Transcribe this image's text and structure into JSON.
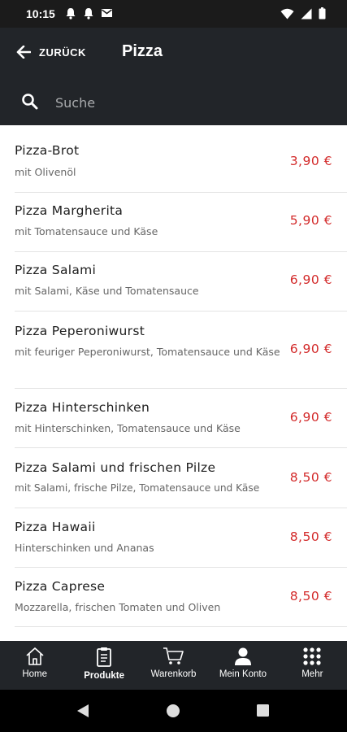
{
  "status_bar": {
    "time": "10:15",
    "icons_left": [
      "notification-bell-icon",
      "notification-bell-icon",
      "mail-icon"
    ],
    "icons_right": [
      "wifi-icon",
      "signal-icon",
      "battery-icon"
    ]
  },
  "header": {
    "back_label": "ZURÜCK",
    "title": "Pizza",
    "search_placeholder": "Suche",
    "search_value": ""
  },
  "products": [
    {
      "name": "Pizza-Brot",
      "description": "mit Olivenöl",
      "price": "3,90 €"
    },
    {
      "name": "Pizza Margherita",
      "description": "mit Tomatensauce und Käse",
      "price": "5,90 €"
    },
    {
      "name": "Pizza Salami",
      "description": "mit Salami, Käse und Tomatensauce",
      "price": "6,90 €"
    },
    {
      "name": "Pizza Peperoniwurst",
      "description": "mit feuriger Peperoniwurst, Tomatensauce und Käse",
      "price": "6,90 €"
    },
    {
      "name": "Pizza Hinterschinken",
      "description": "mit Hinterschinken, Tomatensauce und Käse",
      "price": "6,90 €"
    },
    {
      "name": "Pizza Salami und frischen Pilze",
      "description": "mit Salami, frische Pilze, Tomatensauce und Käse",
      "price": "8,50 €"
    },
    {
      "name": "Pizza Hawaii",
      "description": "Hinterschinken und Ananas",
      "price": "8,50 €"
    },
    {
      "name": "Pizza Caprese",
      "description": "Mozzarella, frischen Tomaten und Oliven",
      "price": "8,50 €"
    }
  ],
  "bottom_nav": {
    "active": "Produkte",
    "items": [
      {
        "label": "Home",
        "icon": "home-icon"
      },
      {
        "label": "Produkte",
        "icon": "menu-card-icon"
      },
      {
        "label": "Warenkorb",
        "icon": "cart-icon"
      },
      {
        "label": "Mein Konto",
        "icon": "user-icon"
      },
      {
        "label": "Mehr",
        "icon": "grid-icon"
      }
    ]
  },
  "colors": {
    "header_bg": "#222529",
    "status_bg": "#1b1b1b",
    "price": "#d32b2b",
    "divider": "#e3e3e3"
  }
}
